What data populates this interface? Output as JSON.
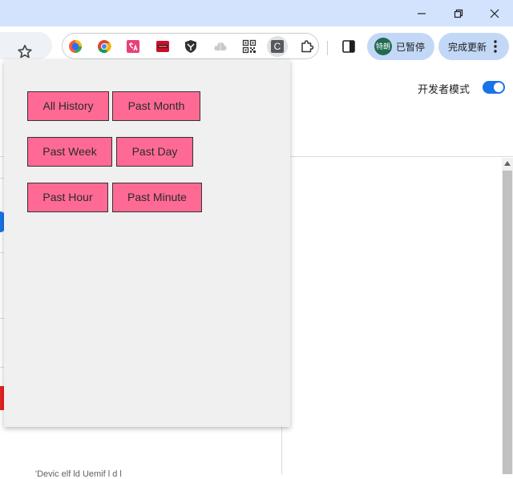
{
  "toolbar": {
    "extensions": [
      {
        "name": "colorful-orb-icon"
      },
      {
        "name": "google-chrome-icon"
      },
      {
        "name": "translate-icon"
      },
      {
        "name": "red-app-icon"
      },
      {
        "name": "shield-icon"
      },
      {
        "name": "cloud-icon"
      },
      {
        "name": "qr-code-icon"
      },
      {
        "name": "letter-c-icon",
        "letter": "C",
        "active": true
      },
      {
        "name": "puzzle-icon"
      }
    ],
    "profile": {
      "avatar_text": "特朗",
      "label": "已暂停"
    },
    "update_label": "完成更新"
  },
  "page": {
    "developer_mode_label": "开发者模式",
    "developer_mode_on": true,
    "bottom_text": "'Devic     elf ld     Uemif     l     d     l"
  },
  "popup": {
    "buttons": [
      {
        "label": "All History"
      },
      {
        "label": "Past Month"
      },
      {
        "label": "Past Week"
      },
      {
        "label": "Past Day"
      },
      {
        "label": "Past Hour"
      },
      {
        "label": "Past Minute"
      }
    ]
  },
  "colors": {
    "titlebar": "#d3e3fd",
    "button_pink": "#ff6a95",
    "toggle_blue": "#1a73e8",
    "popup_bg": "#f0f0f0"
  }
}
